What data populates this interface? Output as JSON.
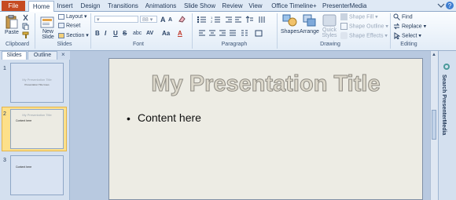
{
  "tabs": {
    "file": "File",
    "items": [
      "Home",
      "Insert",
      "Design",
      "Transitions",
      "Animations",
      "Slide Show",
      "Review",
      "View",
      "Office Timeline+",
      "PresenterMedia"
    ]
  },
  "ribbon": {
    "clipboard": {
      "paste": "Paste",
      "label": "Clipboard"
    },
    "slides": {
      "new_slide": "New Slide",
      "layout": "Layout",
      "reset": "Reset",
      "section": "Section",
      "label": "Slides"
    },
    "font": {
      "size": "88",
      "label": "Font",
      "bold": "B",
      "italic": "I",
      "underline": "U",
      "strike": "S",
      "shadow": "abc",
      "spacing": "AV",
      "case": "Aa",
      "grow": "A",
      "shrink": "A",
      "color": "A"
    },
    "paragraph": {
      "label": "Paragraph"
    },
    "drawing": {
      "shapes": "Shapes",
      "arrange": "Arrange",
      "quick_styles": "Quick Styles",
      "fill": "Shape Fill",
      "outline": "Shape Outline",
      "effects": "Shape Effects",
      "label": "Drawing"
    },
    "editing": {
      "find": "Find",
      "replace": "Replace",
      "select": "Select",
      "label": "Editing"
    }
  },
  "panel": {
    "tab_slides": "Slides",
    "tab_outline": "Outline",
    "close": "×",
    "thumbs": [
      {
        "num": "1",
        "title": "My Presentation Title",
        "sub": "Presentation Title Goes"
      },
      {
        "num": "2",
        "title": "My Presentation Title",
        "sub": "Content here"
      },
      {
        "num": "3",
        "title": "",
        "sub": "Content here"
      }
    ]
  },
  "slide": {
    "title": "My Presentation Title",
    "bullet": "•",
    "content": "Content here"
  },
  "side_pane": {
    "label": "Search PresenterMedia"
  }
}
